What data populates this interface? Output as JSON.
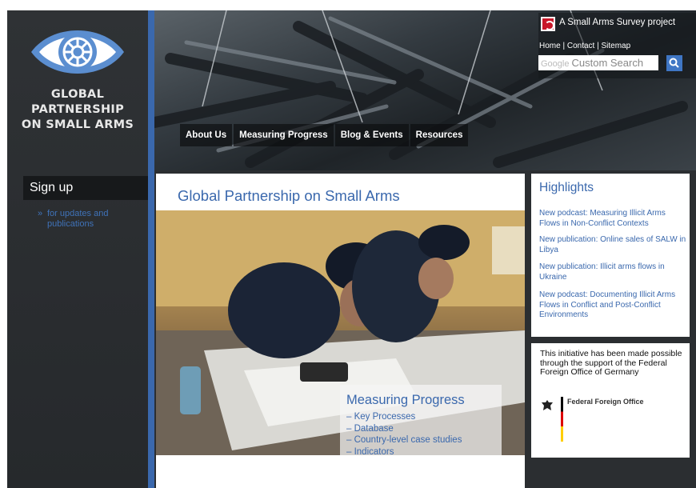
{
  "brand": {
    "line1": "GLOBAL",
    "line2": "PARTNERSHIP",
    "line3": "ON SMALL ARMS"
  },
  "sidebar": {
    "signup_title": "Sign up",
    "signup_bullet": "»",
    "signup_link": "for updates and publications"
  },
  "header": {
    "project_label": "A Small Arms Survey project",
    "links": {
      "home": "Home",
      "sep1": " | ",
      "contact": "Contact",
      "sep2": " | ",
      "sitemap": "Sitemap"
    },
    "search": {
      "google_label": "Google",
      "placeholder": "Custom Search"
    }
  },
  "nav": {
    "items": [
      {
        "label": "About Us"
      },
      {
        "label": "Measuring Progress"
      },
      {
        "label": "Blog & Events"
      },
      {
        "label": "Resources"
      }
    ]
  },
  "main": {
    "title": "Global Partnership on Small Arms",
    "feature": {
      "title": "Measuring Progress",
      "items": [
        "– Key Processes",
        "– Database",
        "– Country-level case studies",
        "– Indicators"
      ]
    }
  },
  "highlights": {
    "title": "Highlights",
    "items": [
      "New podcast: Measuring Illicit Arms Flows in Non-Conflict Contexts",
      "New publication: Online sales of SALW in Libya",
      "New publication: Illicit arms flows in Ukraine",
      "New podcast: Documenting Illicit Arms Flows in Conflict and Post-Conflict Environments"
    ]
  },
  "support": {
    "text": "This initiative has been made possible through the support of the Federal Foreign Office of Germany",
    "office_label": "Federal Foreign Office"
  },
  "colors": {
    "accent_blue": "#3a68ad",
    "sidebar_bg": "#2b2e31",
    "sas_red": "#c8182a"
  }
}
